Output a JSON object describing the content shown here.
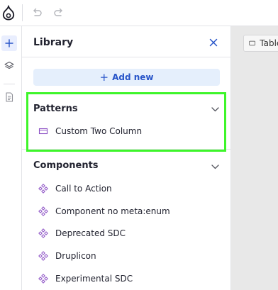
{
  "toolbar": {
    "logo_icon": "drupal-drop-icon",
    "undo_icon": "undo-icon",
    "redo_icon": "redo-icon"
  },
  "rail": {
    "items": [
      {
        "icon": "plus-icon",
        "active": true
      },
      {
        "icon": "layers-icon",
        "active": false
      },
      {
        "icon": "page-icon",
        "active": false
      }
    ]
  },
  "library": {
    "title": "Library",
    "add_new_label": "Add new",
    "sections": {
      "patterns": {
        "title": "Patterns",
        "items": [
          {
            "label": "Custom Two Column",
            "icon": "pattern-icon"
          }
        ]
      },
      "components": {
        "title": "Components",
        "items": [
          {
            "label": "Call to Action",
            "icon": "component-icon"
          },
          {
            "label": "Component no meta:enum",
            "icon": "component-icon"
          },
          {
            "label": "Deprecated SDC",
            "icon": "component-icon"
          },
          {
            "label": "Druplicon",
            "icon": "component-icon"
          },
          {
            "label": "Experimental SDC",
            "icon": "component-icon"
          }
        ]
      }
    }
  },
  "canvas": {
    "device_label": "Tablet",
    "device_icon": "tablet-icon"
  },
  "colors": {
    "accent": "#2855c9",
    "add_new_bg": "#e5effc",
    "highlight": "#3ef52a",
    "component_icon": "#8b4fc4"
  }
}
